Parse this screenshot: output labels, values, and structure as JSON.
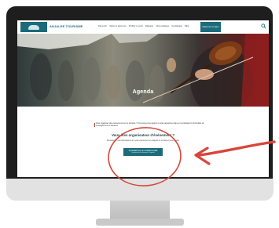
{
  "site": {
    "logo_text": "ANJALEE TOURISME",
    "nav_items": [
      "Découvrir",
      "Visiter et séjourner",
      "Profitez et sortir",
      "Déplacer",
      "Infos pratiques",
      "Se déplacer",
      "Blog"
    ],
    "nav_cta": "Réservez en ligne"
  },
  "hero": {
    "title": "Agenda"
  },
  "content": {
    "notice": "Vous organisez des événements sur le territoire ? Vous pouvez les ajouter à notre agenda en ligne en remplissant le formulaire de renseignement ci-dessous.",
    "cta_heading": "Vous êtes organisateur d'événement ?",
    "cta_sub": "Renseignez vos informations sur votre événement en cliquant ici et laissez-vous guider",
    "cta_button": "JE REMPLIS LE FORMULAIRE",
    "cta_button_small": "Inscription de l'événement à l'agenda"
  },
  "colors": {
    "brand": "#1b6b7c",
    "annotation": "#d7463a"
  }
}
